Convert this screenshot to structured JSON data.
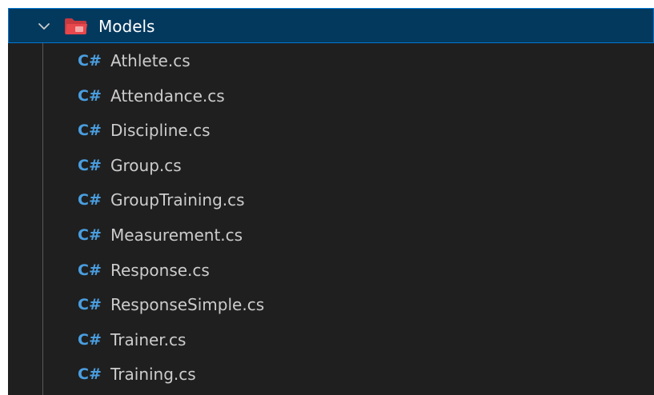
{
  "folder": {
    "label": "Models",
    "expanded": true,
    "icon": "folder-open-icon",
    "icon_color": "#e8474c"
  },
  "files": [
    {
      "label": "Athlete.cs",
      "icon_text": "C#"
    },
    {
      "label": "Attendance.cs",
      "icon_text": "C#"
    },
    {
      "label": "Discipline.cs",
      "icon_text": "C#"
    },
    {
      "label": "Group.cs",
      "icon_text": "C#"
    },
    {
      "label": "GroupTraining.cs",
      "icon_text": "C#"
    },
    {
      "label": "Measurement.cs",
      "icon_text": "C#"
    },
    {
      "label": "Response.cs",
      "icon_text": "C#"
    },
    {
      "label": "ResponseSimple.cs",
      "icon_text": "C#"
    },
    {
      "label": "Trainer.cs",
      "icon_text": "C#"
    },
    {
      "label": "Training.cs",
      "icon_text": "C#"
    }
  ],
  "colors": {
    "background": "#1f1f1f",
    "selection_background": "#04395e",
    "selection_border": "#0078d4",
    "csharp_icon": "#4a9ee0",
    "text": "#cccccc"
  }
}
